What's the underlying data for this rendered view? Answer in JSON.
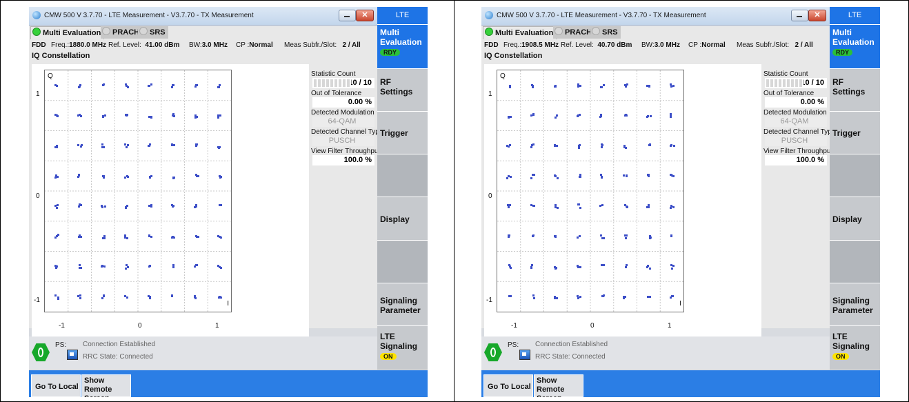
{
  "panels": [
    {
      "window_title": "CMW 500 V 3.7.70 - LTE Measurement  - V3.7.70 - TX Measurement",
      "tabs": {
        "active": "Multi Evaluation",
        "tab2": "PRACH",
        "tab3": "SRS"
      },
      "info": {
        "duplex": "FDD",
        "freq_label": "Freq.:",
        "freq_value": "1880.0 MHz",
        "ref_label": "Ref. Level:",
        "ref_value": "41.00 dBm",
        "bw_label": "BW:",
        "bw_value": "3.0 MHz",
        "cp_label": "CP :",
        "cp_value": "Normal",
        "subfr_label": "Meas Subfr./Slot:",
        "subfr_value": "2  / All"
      },
      "section_title": "IQ Constellation",
      "plot": {
        "q_label": "Q",
        "i_label": "I",
        "y_ticks": [
          "1",
          "0",
          "-1"
        ],
        "x_ticks": [
          "-1",
          "0",
          "1"
        ]
      },
      "stats": {
        "statistic_count_label": "Statistic Count",
        "statistic_count_value": "10 / 10",
        "out_of_tolerance_label": "Out of Tolerance",
        "out_of_tolerance_value": "0.00  %",
        "detected_modulation_label": "Detected Modulation",
        "detected_modulation_value": "64-QAM",
        "detected_channel_type_label": "Detected Channel Type",
        "detected_channel_type_value": "PUSCH",
        "view_filter_label": "View Filter Throughput",
        "view_filter_value": "100.0  %"
      },
      "status": {
        "ps_label": "PS:",
        "connection": "Connection Established",
        "rrc": "RRC State:     Connected"
      },
      "bottom": {
        "go_to_local": "Go To Local",
        "show_remote_line1": "Show Remote",
        "show_remote_line2": "Screen"
      },
      "side": {
        "header": "LTE",
        "multi_eval_line1": "Multi",
        "multi_eval_line2": "Evaluation",
        "rdy_badge": "RDY",
        "rf_settings_line1": "RF",
        "rf_settings_line2": "Settings",
        "trigger": "Trigger",
        "display": "Display",
        "signaling_line1": "Signaling",
        "signaling_line2": "Parameter",
        "lte_signaling_line1": "LTE",
        "lte_signaling_line2": "Signaling",
        "on_badge": "ON"
      }
    },
    {
      "window_title": "CMW 500 V 3.7.70 - LTE Measurement  - V3.7.70 - TX Measurement",
      "tabs": {
        "active": "Multi Evaluation",
        "tab2": "PRACH",
        "tab3": "SRS"
      },
      "info": {
        "duplex": "FDD",
        "freq_label": "Freq.:",
        "freq_value": "1908.5 MHz",
        "ref_label": "Ref. Level:",
        "ref_value": "40.70 dBm",
        "bw_label": "BW:",
        "bw_value": "3.0 MHz",
        "cp_label": "CP :",
        "cp_value": "Normal",
        "subfr_label": "Meas Subfr./Slot:",
        "subfr_value": "2  / All"
      },
      "section_title": "IQ Constellation",
      "plot": {
        "q_label": "Q",
        "i_label": "I",
        "y_ticks": [
          "1",
          "0",
          "-1"
        ],
        "x_ticks": [
          "-1",
          "0",
          "1"
        ]
      },
      "stats": {
        "statistic_count_label": "Statistic Count",
        "statistic_count_value": "10 / 10",
        "out_of_tolerance_label": "Out of Tolerance",
        "out_of_tolerance_value": "0.00  %",
        "detected_modulation_label": "Detected Modulation",
        "detected_modulation_value": "64-QAM",
        "detected_channel_type_label": "Detected Channel Type",
        "detected_channel_type_value": "PUSCH",
        "view_filter_label": "View Filter Throughput",
        "view_filter_value": "100.0  %"
      },
      "status": {
        "ps_label": "PS:",
        "connection": "Connection Established",
        "rrc": "RRC State:     Connected"
      },
      "bottom": {
        "go_to_local": "Go To Local",
        "show_remote_line1": "Show Remote",
        "show_remote_line2": "Screen"
      },
      "side": {
        "header": "LTE",
        "multi_eval_line1": "Multi",
        "multi_eval_line2": "Evaluation",
        "rdy_badge": "RDY",
        "rf_settings_line1": "RF",
        "rf_settings_line2": "Settings",
        "trigger": "Trigger",
        "display": "Display",
        "signaling_line1": "Signaling",
        "signaling_line2": "Parameter",
        "lte_signaling_line1": "LTE",
        "lte_signaling_line2": "Signaling",
        "on_badge": "ON"
      }
    }
  ],
  "colors": {
    "accent_blue": "#1e74e6",
    "ready_green": "#2ac03a",
    "on_yellow": "#ffe400",
    "constellation": "#3d4fc8"
  }
}
